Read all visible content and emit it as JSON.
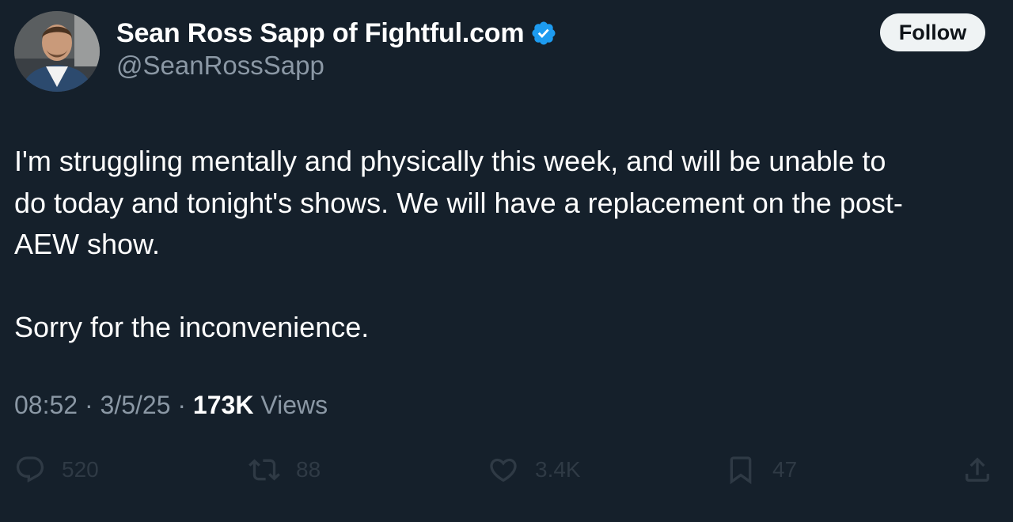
{
  "author": {
    "display_name": "Sean Ross Sapp of Fightful.com",
    "handle": "@SeanRossSapp",
    "verified": true
  },
  "follow_button": {
    "label": "Follow"
  },
  "tweet": {
    "paragraphs": [
      "I'm struggling mentally and physically this week, and will be unable to\ndo today and tonight's shows. We will have a replacement on the post-\nAEW show.",
      "Sorry for the inconvenience."
    ]
  },
  "meta": {
    "time": "08:52",
    "separator": "·",
    "date": "3/5/25",
    "views_count": "173K",
    "views_label": "Views"
  },
  "actions": {
    "reply": {
      "icon": "reply-icon",
      "count": "520"
    },
    "retweet": {
      "icon": "retweet-icon",
      "count": "88"
    },
    "like": {
      "icon": "heart-icon",
      "count": "3.4K"
    },
    "bookmark": {
      "icon": "bookmark-icon",
      "count": "47"
    },
    "share": {
      "icon": "share-icon"
    }
  },
  "colors": {
    "background": "#15202b",
    "text_primary": "#ffffff",
    "text_secondary": "#8b98a5",
    "action_dim": "#2f3a45",
    "verified_blue": "#1d9bf0",
    "follow_bg": "#eff3f4"
  }
}
